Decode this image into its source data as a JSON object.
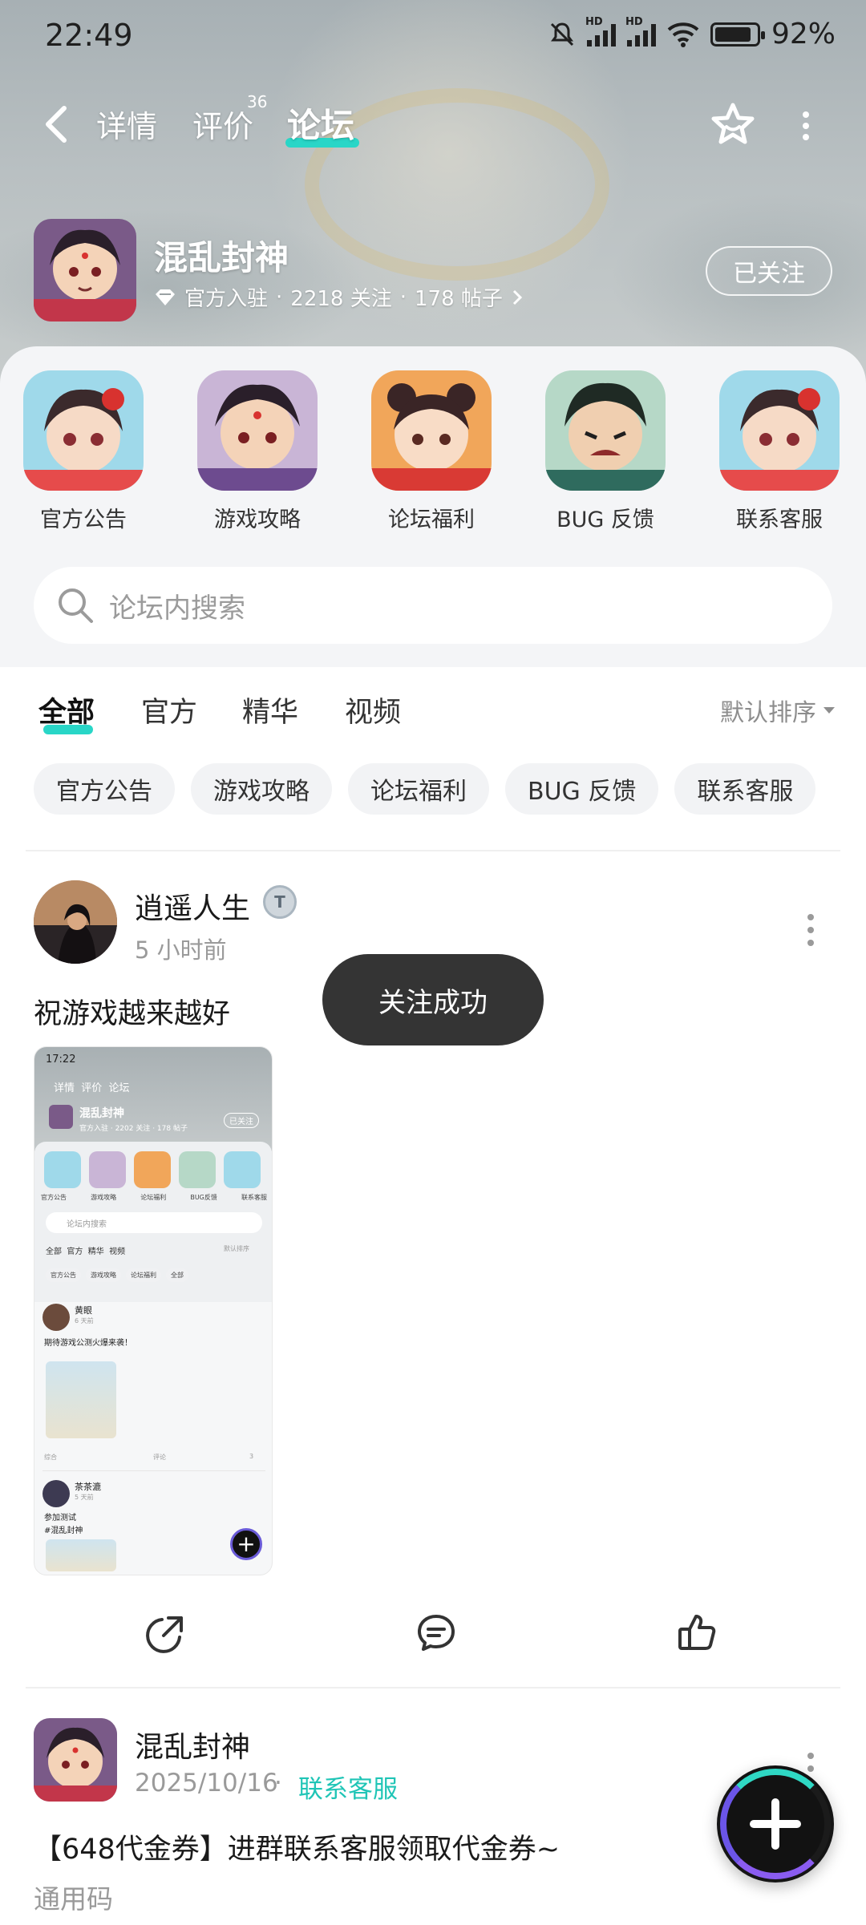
{
  "status_bar": {
    "time": "22:49",
    "hd1": "HD",
    "hd2": "HD",
    "battery": "92%"
  },
  "nav": {
    "tabs": [
      {
        "label": "详情"
      },
      {
        "label": "评价",
        "badge": "36"
      },
      {
        "label": "论坛"
      }
    ],
    "active_tab": "论坛"
  },
  "game": {
    "name": "混乱封神",
    "official": "官方入驻",
    "follows": "2218 关注",
    "posts": "178 帖子",
    "follow_button": "已关注"
  },
  "sections": [
    {
      "label": "官方公告"
    },
    {
      "label": "游戏攻略"
    },
    {
      "label": "论坛福利"
    },
    {
      "label": "BUG 反馈"
    },
    {
      "label": "联系客服"
    }
  ],
  "search": {
    "placeholder": "论坛内搜索"
  },
  "filter_tabs": [
    {
      "label": "全部"
    },
    {
      "label": "官方"
    },
    {
      "label": "精华"
    },
    {
      "label": "视频"
    }
  ],
  "sort_label": "默认排序",
  "chips": [
    "官方公告",
    "游戏攻略",
    "论坛福利",
    "BUG 反馈",
    "联系客服"
  ],
  "posts": [
    {
      "author": "逍遥人生",
      "time": "5 小时前",
      "text": "祝游戏越来越好",
      "thumbnail": {
        "time": "17:22",
        "tabs": "详情  评价  论坛",
        "game_name": "混乱封神",
        "follow": "已关注",
        "meta": "官方入驻 · 2202 关注 · 178 帖子",
        "section_labels": [
          "官方公告",
          "游戏攻略",
          "论坛福利",
          "BUG反馈",
          "联系客服"
        ],
        "search": "论坛内搜索",
        "filters": "全部  官方  精华  视频",
        "sort": "默认排序",
        "chips": [
          "官方公告",
          "游戏攻略",
          "论坛福利",
          "全部"
        ],
        "post1_author": "黄眼",
        "post1_time": "6 天前",
        "post1_text": "期待游戏公测火爆来袭！",
        "post1_footer": "综合",
        "post1_comment": "评论",
        "post1_likes": "3",
        "post2_author": "茶茶漉",
        "post2_time": "5 天前",
        "post2_text1": "参加测试",
        "post2_text2": "#混乱封神"
      }
    },
    {
      "author": "混乱封神",
      "time": "2025/10/16",
      "tag": "联系客服",
      "title": "【648代金券】进群联系客服领取代金券~",
      "subtitle": "通用码"
    }
  ],
  "toast": "关注成功",
  "icons": {
    "back": "chevron-left-icon",
    "star": "star-icon",
    "more": "more-vertical-icon",
    "search": "search-icon",
    "share": "share-icon",
    "comment": "comment-icon",
    "like": "thumbs-up-icon",
    "plus": "plus-icon"
  },
  "colors": {
    "accent": "#29d6c7",
    "tag": "#20c5b6",
    "toast_bg": "#343434"
  }
}
